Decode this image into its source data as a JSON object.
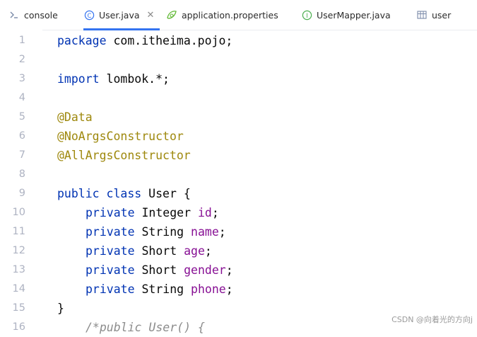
{
  "tabs": [
    {
      "label": "console",
      "icon": "console-icon",
      "active": false
    },
    {
      "label": "User.java",
      "icon": "class-icon",
      "active": true
    },
    {
      "label": "application.properties",
      "icon": "properties-icon",
      "active": false
    },
    {
      "label": "UserMapper.java",
      "icon": "interface-icon",
      "active": false
    },
    {
      "label": "user",
      "icon": "table-icon",
      "active": false
    }
  ],
  "line_numbers": [
    "1",
    "2",
    "3",
    "4",
    "5",
    "6",
    "7",
    "8",
    "9",
    "10",
    "11",
    "12",
    "13",
    "14",
    "15",
    "16"
  ],
  "code": {
    "l1_kw": "package",
    "l1_rest": " com.itheima.pojo;",
    "l3_kw": "import",
    "l3_rest": " lombok.*;",
    "l5": "@Data",
    "l6": "@NoArgsConstructor",
    "l7": "@AllArgsConstructor",
    "l9_kw": "public class",
    "l9_rest": " User {",
    "l10_kw": "private",
    "l10_type": " Integer ",
    "l10_field": "id",
    "l10_end": ";",
    "l11_kw": "private",
    "l11_type": " String ",
    "l11_field": "name",
    "l11_end": ";",
    "l12_kw": "private",
    "l12_type": " Short ",
    "l12_field": "age",
    "l12_end": ";",
    "l13_kw": "private",
    "l13_type": " Short ",
    "l13_field": "gender",
    "l13_end": ";",
    "l14_kw": "private",
    "l14_type": " String ",
    "l14_field": "phone",
    "l14_end": ";",
    "l15": "}",
    "l16": "/*public User() {"
  },
  "watermark": "CSDN @向着光的方向j",
  "colors": {
    "keyword": "#0033b3",
    "annotation": "#9e880d",
    "field": "#871094",
    "line_number": "#aeb3c2",
    "active_tab_underline": "#3574f0"
  }
}
